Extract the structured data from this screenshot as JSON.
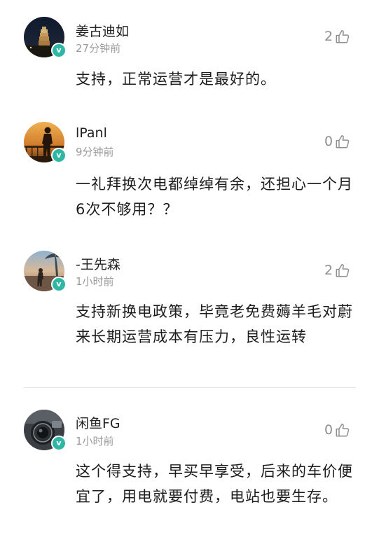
{
  "comments": [
    {
      "user": "姜古迪如",
      "time": "27分钟前",
      "likes": "2",
      "text": "支持，正常运营才是最好的。",
      "avatar_icon": "pagoda-night-avatar"
    },
    {
      "user": "lPanl",
      "time": "9分钟前",
      "likes": "0",
      "text": "一礼拜换次电都绰绰有余，还担心一个月6次不够用？？",
      "avatar_icon": "sunset-silhouette-avatar"
    },
    {
      "user": "-王先森",
      "time": "1小时前",
      "likes": "2",
      "text": "支持新换电政策，毕竟老免费薅羊毛对蔚来长期运营成本有压力，良性运转",
      "avatar_icon": "beach-silhouette-avatar"
    },
    {
      "user": "闲鱼FG",
      "time": "1小时前",
      "likes": "0",
      "text": "这个得支持，早买早享受，后来的车价便宜了，用电就要付费，电站也要生存。",
      "avatar_icon": "camera-lens-avatar"
    }
  ],
  "colors": {
    "verified_badge": "#2fb6a5",
    "meta_text": "#9a9a9a",
    "like_icon": "#8e8e8e"
  }
}
